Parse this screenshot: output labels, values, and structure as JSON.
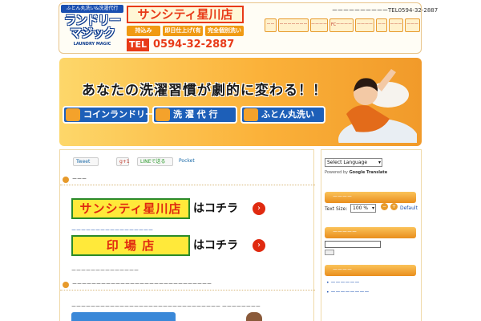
{
  "logo": {
    "tagline": "ふとん丸洗い&洗濯代行",
    "name_line1": "ランドリー",
    "name_line2": "マジック",
    "sub": "LAUNDRY MAGIC"
  },
  "store": {
    "title": "サンシティ星川店",
    "badges": [
      "持込み",
      "即日仕上げ(有料)",
      "完全個別洗い"
    ],
    "tel_label": "TEL",
    "tel_number": "0594-32-2887"
  },
  "header": {
    "tel_text": "ーーーーーーーーーーTEL0594-32-2887",
    "nav": [
      "ーーー",
      "ーーーーーーーー",
      "ーーーー",
      "FCーーーー",
      "ーーーーー",
      "ーー",
      "ーーー",
      "ーーー"
    ]
  },
  "banner": {
    "headline": "あなたの洗濯習慣が劇的に変わる！！",
    "buttons": [
      "コインランドリー",
      "洗 濯 代 行",
      "ふとん丸洗い"
    ]
  },
  "social": {
    "tweet": "Tweet",
    "gplus": "g+1",
    "line": "LINEで送る",
    "pocket": "Pocket"
  },
  "main": {
    "section1_title": "ーーー",
    "store_link1": "サンシティ星川店",
    "store_link2": "印 場 店",
    "kochira": "はコチラ",
    "arrow": "›",
    "small_link1": "ーーーーーーーーーーーーーーーーー",
    "text1": "ーーーーーーーーーーーーーー",
    "section2_title": "ーーーーーーーーーーーーーーーーーーーーーーーーーーーーー",
    "text2": "ーーーーーーーーーーーーーーーーーーーーーーーーーーーーーーー ーーーーーーーー"
  },
  "sidebar": {
    "language_select": "Select Language",
    "powered_by": "Powered by",
    "google_translate": "Google Translate",
    "head1": "ーーーー",
    "text_size_label": "Text Size:",
    "text_size_value": "100 %",
    "zoom_minus": "−",
    "zoom_plus": "+",
    "default_label": "Default",
    "head2": "ーーーーー",
    "head3": "ーーーー",
    "list": [
      "ーーーーーー",
      "ーーーーーーーー"
    ]
  },
  "colors": {
    "brand_orange": "#f09a12",
    "brand_red": "#e83a18",
    "brand_blue": "#1a4fb0",
    "store_yellow": "#ffe93a",
    "store_green": "#2a8a2a"
  },
  "icons": {
    "logo": "laundry-magic-logo",
    "coin": "coin-laundry-icon",
    "wash": "laundry-agency-icon",
    "futon": "futon-icon",
    "arrow": "chevron-right-icon"
  }
}
